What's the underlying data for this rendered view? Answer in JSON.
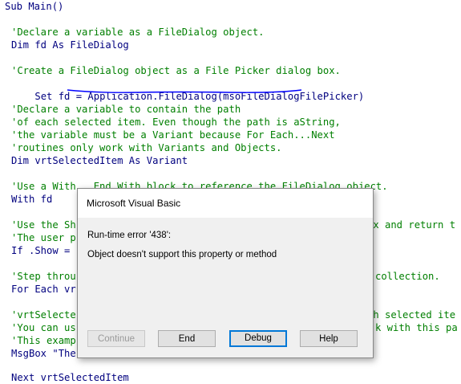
{
  "code": {
    "lines": [
      {
        "text": "Sub Main()",
        "type": "code",
        "top": 0
      },
      {
        "text": "'Declare a variable as a FileDialog object.",
        "type": "comment"
      },
      {
        "text": "Dim fd As FileDialog",
        "type": "code"
      },
      {
        "text": "'Create a FileDialog object as a File Picker dialog box.",
        "type": "comment"
      },
      {
        "text": "Set fd = Application.FileDialog(msoFileDialogFilePicker)",
        "type": "code"
      },
      {
        "text": "'Declare a variable to contain the path",
        "type": "comment"
      },
      {
        "text": "'of each selected item. Even though the path is aString,",
        "type": "comment"
      },
      {
        "text": "'the variable must be a Variant because For Each...Next",
        "type": "comment"
      },
      {
        "text": "'routines only work with Variants and Objects.",
        "type": "comment"
      },
      {
        "text": "Dim vrtSelectedItem As Variant",
        "type": "code"
      },
      {
        "text": "'Use a With...End With block to reference the FileDialog object.",
        "type": "comment"
      },
      {
        "text": "With fd",
        "type": "code"
      },
      {
        "text": "'Use the Sh",
        "type": "comment"
      },
      {
        "text": "ox and return t",
        "type": "comment"
      },
      {
        "text": "'The user p",
        "type": "comment"
      },
      {
        "text": "If .Show =",
        "type": "code"
      },
      {
        "text": "'Step throu",
        "type": "comment"
      },
      {
        "text": "collection.",
        "type": "comment"
      },
      {
        "text": "For Each vr",
        "type": "code"
      },
      {
        "text": "'vrtSelecte",
        "type": "comment"
      },
      {
        "text": "ch selected ite",
        "type": "comment"
      },
      {
        "text": "'You can us",
        "type": "comment"
      },
      {
        "text": "k with this pa",
        "type": "comment"
      },
      {
        "text": "'This examp",
        "type": "comment"
      },
      {
        "text": "MsgBox \"The",
        "type": "code"
      },
      {
        "text": "Next vrtSelectedItem",
        "type": "code"
      }
    ]
  },
  "dialog": {
    "title": "Microsoft Visual Basic",
    "error_line": "Run-time error '438':",
    "message": "Object doesn't support this property or method",
    "buttons": {
      "continue": "Continue",
      "end": "End",
      "debug": "Debug",
      "help": "Help"
    }
  },
  "colors": {
    "keyword": "#00007f",
    "comment": "#007f00",
    "squiggle": "#0000ff",
    "default_button_border": "#0078d7"
  }
}
